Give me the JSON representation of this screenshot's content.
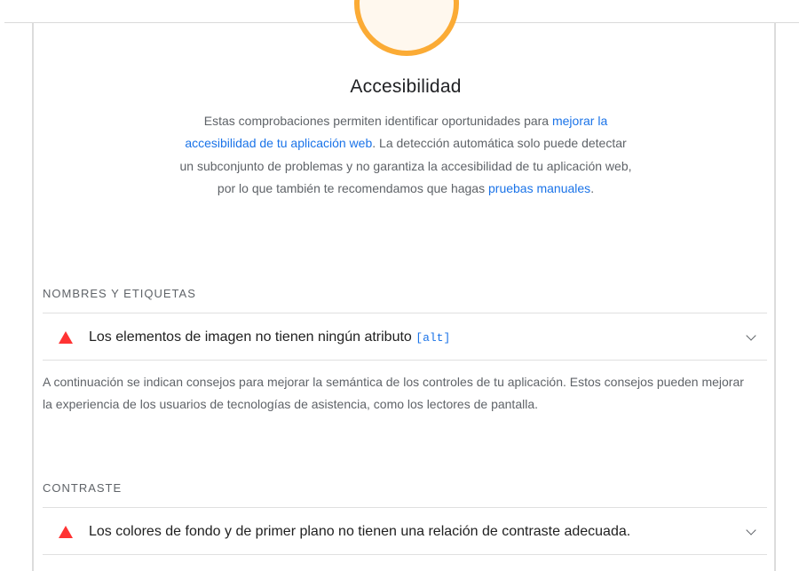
{
  "category": {
    "title": "Accesibilidad",
    "description_parts": [
      "Estas comprobaciones permiten identificar oportunidades para ",
      "mejorar la accesibilidad de tu aplicación web",
      ". La detección automática solo puede detectar un subconjunto de problemas y no garantiza la accesibilidad de tu aplicación web, por lo que también te recomendamos que hagas ",
      "pruebas manuales",
      "."
    ],
    "gauge_color": "#fbab35"
  },
  "groups": [
    {
      "title": "NOMBRES Y ETIQUETAS",
      "audit": {
        "text": "Los elementos de imagen no tienen ningún atributo ",
        "code": "[alt]",
        "status": "fail"
      },
      "description": "A continuación se indican consejos para mejorar la semántica de los controles de tu aplicación. Estos consejos pueden mejorar la experiencia de los usuarios de tecnologías de asistencia, como los lectores de pantalla."
    },
    {
      "title": "CONTRASTE",
      "audit": {
        "text": "Los colores de fondo y de primer plano no tienen una relación de contraste adecuada.",
        "code": "",
        "status": "fail"
      }
    }
  ],
  "colors": {
    "fail": "#ff3333",
    "link": "#1a73e8",
    "average": "#fbab35"
  },
  "icons": {
    "fail": "fail-triangle-icon",
    "expand": "chevron-down-icon"
  }
}
